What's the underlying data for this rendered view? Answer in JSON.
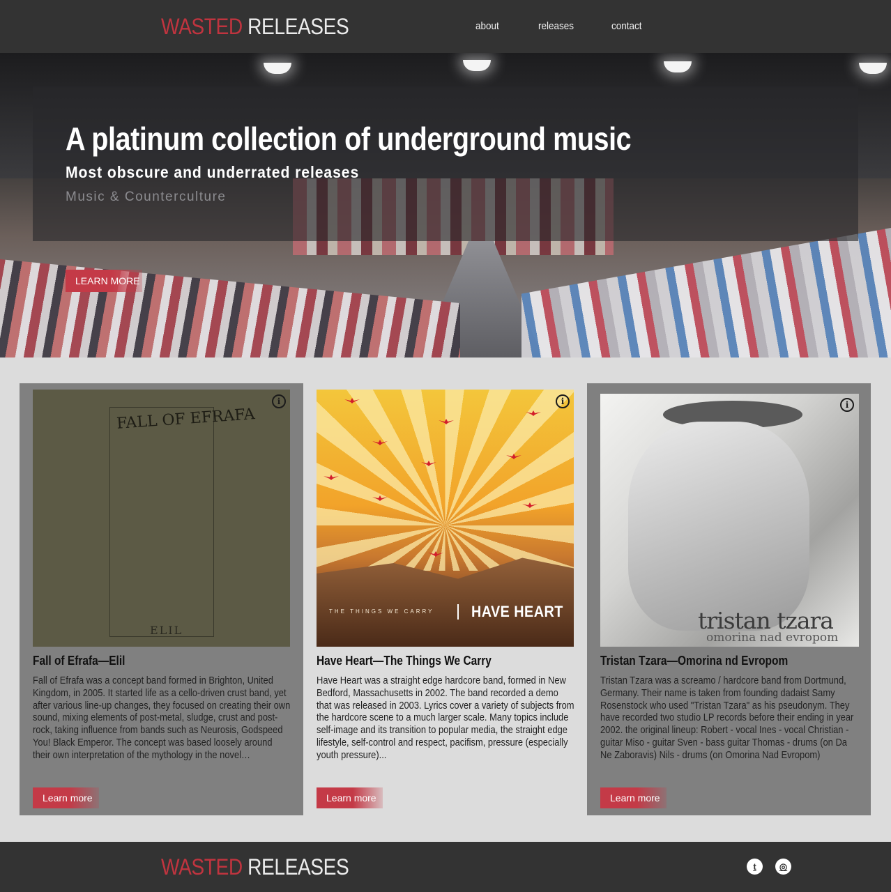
{
  "header": {
    "logo_word1": "WASTED",
    "logo_word2": "RELEASES",
    "nav": [
      "about",
      "releases",
      "contact"
    ]
  },
  "hero": {
    "title": "A platinum collection of underground music",
    "subtitle": "Most obscure and underrated releases",
    "kicker": "Music & Counterculture",
    "button": "LEARN MORE"
  },
  "releases": [
    {
      "title": "Fall of Efrafa—Elil",
      "description": "Fall of Efrafa was a concept band formed in Brighton, United Kingdom, in 2005. It started life as a cello-driven crust band, yet after various line-up changes, they focused on creating their own sound, mixing elements of post-metal, sludge, crust and post-rock, taking influence from bands such as Neurosis, Godspeed You! Black Emperor. The concept was based loosely around their own interpretation of the mythology in the novel…",
      "art_text_band": "FALL OF EFRAFA",
      "art_text_album": "ELIL",
      "button": "Learn more"
    },
    {
      "title": "Have Heart—The Things We Carry",
      "description": "Have Heart was a straight edge hardcore band, formed in New Bedford, Massachusetts in 2002. The band recorded a demo that was released in 2003. Lyrics cover a variety of subjects from the hardcore scene to a much larger scale. Many topics include self-image and its transition to popular media, the straight edge lifestyle, self-control and respect, pacifism, pressure (especially youth pressure)...",
      "art_text_band": "HAVE HEART",
      "art_text_album": "THE THINGS WE CARRY",
      "button": "Learn more"
    },
    {
      "title": "Tristan Tzara—Omorina nd Evropom",
      "description": "Tristan Tzara was a screamo / hardcore band from Dortmund, Germany. Their name is taken from founding dadaist Samy Rosenstock who used \"Tristan Tzara\" as his pseudonym. They have recorded two studio LP records before their ending in year 2002. the original lineup: Robert - vocal Ines - vocal Christian - guitar Miso - guitar Sven - bass guitar Thomas - drums (on Da Ne Zaboravis) Nils - drums (on Omorina Nad Evropom)",
      "art_text_band": "tristan tzara",
      "art_text_album": "omorina nad evropom",
      "button": "Learn more"
    }
  ],
  "footer": {
    "logo_word1": "WASTED",
    "logo_word2": "RELEASES",
    "social": [
      "twitter-icon",
      "instagram-icon"
    ]
  },
  "colors": {
    "header_bg": "#333333",
    "accent": "#c0343f",
    "page_bg": "#dcdcdc",
    "card_bg": "#808080"
  }
}
